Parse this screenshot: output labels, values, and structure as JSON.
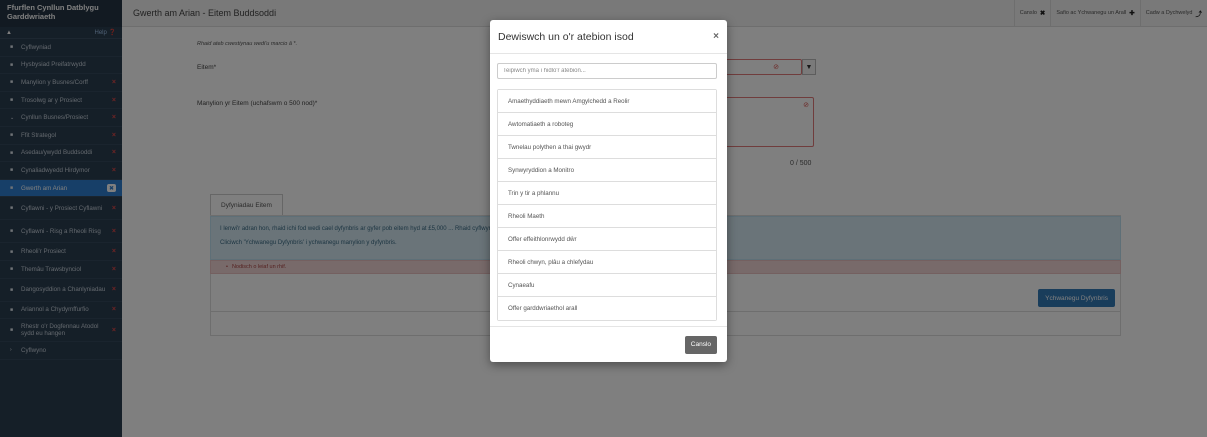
{
  "sidebar": {
    "title": "Ffurflen Cynllun Datblygu Garddwriaeth",
    "help_label": "Help",
    "items": [
      {
        "label": "Cyflwyniad",
        "error": false
      },
      {
        "label": "Hysbysiad Preifatrwydd",
        "error": false
      },
      {
        "label": "Manylion y Busnes/Corff",
        "error": true
      },
      {
        "label": "Trosolwg ar y Prosiect",
        "error": true
      },
      {
        "label": "Cynllun Busnes/Prosiect",
        "error": true
      },
      {
        "label": "Ffit Strategol",
        "error": true
      },
      {
        "label": "Asedau/ywydd Buddsoddi",
        "error": true
      },
      {
        "label": "Cynaliadwyedd Hirdymor",
        "error": true
      },
      {
        "label": "Gwerth am Arian",
        "error": false,
        "active": true
      },
      {
        "label": "Cyflawni - y Prosiect Cyflawni",
        "error": true
      },
      {
        "label": "Cyflawni - Risg a Rheoli Risg",
        "error": true
      },
      {
        "label": "Rheoli'r Prosiect",
        "error": true
      },
      {
        "label": "Themâu Trawsbynciol",
        "error": true
      },
      {
        "label": "Dangosyddion a Chanlyniadau",
        "error": true
      },
      {
        "label": "Ariannol a Chydymffurfio",
        "error": true
      },
      {
        "label": "Rhestr o'r Dogfennau Atodol sydd eu hangen",
        "error": true
      },
      {
        "label": "Cyflwyno",
        "error": false
      }
    ]
  },
  "header": {
    "title": "Gwerth am Arian - Eitem Buddsoddi",
    "cancel_label": "Canslo",
    "save_add_label": "Safio ac Ychwanegu un Arall",
    "save_return_label": "Cadw a Dychwelyd"
  },
  "form": {
    "required_note": "Rhaid ateb cwestiynau wedi'u marcio â *.",
    "item_label": "Eitem*",
    "details_label": "Manylion yr Eitem (uchafswm o 500 nod)*",
    "counter": "0 / 500",
    "tab_label": "Dyfyniadau Eitem",
    "info_line1": "I lenwi'r adran hon, rhaid ichi fod wedi cael dyfynbris ar gyfer pob eitem hyd at £5,000 ... Rhaid cyflwyno tystiolaeth o'r dyfynbrisiau hyn gyda'r cais.",
    "info_line2": "Cliciwch 'Ychwanegu Dyfynbris' i ychwanegu manylion y dyfynbris.",
    "error_text": "Nodisch o leiaf un rhif.",
    "add_quote_label": "Ychwanegu Dyfynbris"
  },
  "modal": {
    "title": "Dewiswch un o'r atebion isod",
    "close_glyph": "×",
    "search_placeholder": "Teipiwch yma i hidlo'r atebion...",
    "options": [
      "Amaethyddiaeth mewn Amgylchedd a Reolir",
      "Awtomatiaeth a roboteg",
      "Twnelau polythen a thai gwydr",
      "Synwyryddion a Monitro",
      "Trin y tir a phlannu",
      "Rheoli Maeth",
      "Offer effeithlonrwydd dŵr",
      "Rheoli chwyn, plâu a chlefydau",
      "Cynaeafu",
      "Offer garddwriaethol arall"
    ],
    "cancel_label": "Canslo"
  }
}
